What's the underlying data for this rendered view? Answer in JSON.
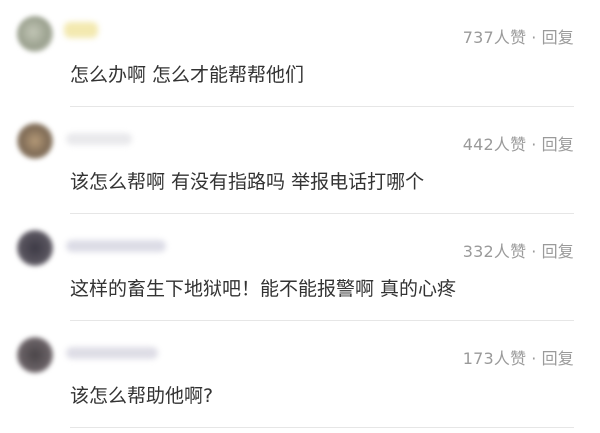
{
  "comments": [
    {
      "likes": "737人赞",
      "dot": "·",
      "reply": "回复",
      "text": "怎么办啊 怎么才能帮帮他们"
    },
    {
      "likes": "442人赞",
      "dot": "·",
      "reply": "回复",
      "text": "该怎么帮啊 有没有指路吗 举报电话打哪个"
    },
    {
      "likes": "332人赞",
      "dot": "·",
      "reply": "回复",
      "text": "这样的畜生下地狱吧！能不能报警啊 真的心疼"
    },
    {
      "likes": "173人赞",
      "dot": "·",
      "reply": "回复",
      "text": "该怎么帮助他啊?"
    }
  ]
}
